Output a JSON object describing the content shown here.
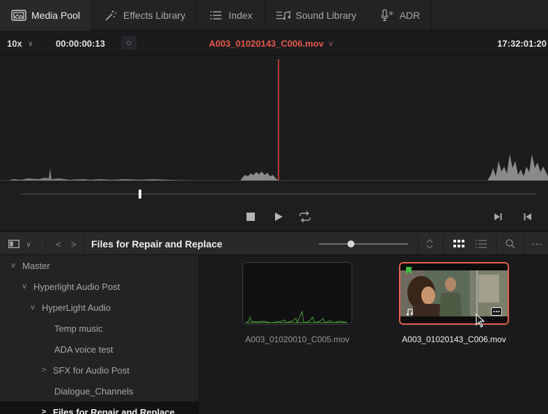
{
  "tabs": [
    {
      "label": "Media Pool",
      "icon": "media-pool-icon"
    },
    {
      "label": "Effects Library",
      "icon": "effects-wand-icon"
    },
    {
      "label": "Index",
      "icon": "index-list-icon"
    },
    {
      "label": "Sound Library",
      "icon": "sound-library-icon"
    },
    {
      "label": "ADR",
      "icon": "microphone-icon"
    }
  ],
  "viewer": {
    "zoom": "10x",
    "timecode": "00:00:00:13",
    "clip_name": "A003_01020143_C006.mov",
    "end_timecode": "17:32:01:20",
    "playhead_color": "#e0483c"
  },
  "transport": {
    "stop_icon": "stop-icon",
    "play_icon": "play-icon",
    "loop_icon": "loop-icon",
    "next_icon": "jump-to-end-icon",
    "prev_icon": "jump-to-start-icon"
  },
  "pool": {
    "bin_title": "Files for Repair and Replace",
    "bins": [
      {
        "label": "Master",
        "caret": "v",
        "level": 0,
        "selected": false
      },
      {
        "label": "Hyperlight Audio Post",
        "caret": "v",
        "level": 1,
        "selected": false
      },
      {
        "label": "HyperLight Audio",
        "caret": "v",
        "level": 2,
        "selected": false
      },
      {
        "label": "Temp music",
        "caret": "",
        "level": 3,
        "selected": false
      },
      {
        "label": "ADA voice test",
        "caret": "",
        "level": 3,
        "selected": false
      },
      {
        "label": "SFX for Audio Post",
        "caret": ">",
        "level": 2,
        "selected": false
      },
      {
        "label": "Dialogue_Channels",
        "caret": "",
        "level": 3,
        "selected": false
      },
      {
        "label": "Files for Repair and Replace",
        "caret": ">",
        "level": 2,
        "selected": true
      }
    ],
    "clips": [
      {
        "name": "A003_01020010_C005.mov",
        "selected": false
      },
      {
        "name": "A003_01020143_C006.mov",
        "selected": true
      }
    ]
  },
  "colors": {
    "accent_red": "#e0483c",
    "selection_border": "#e6604f",
    "waveform": "#8a8a8a",
    "thumb_waveform": "#4e9a3e"
  }
}
